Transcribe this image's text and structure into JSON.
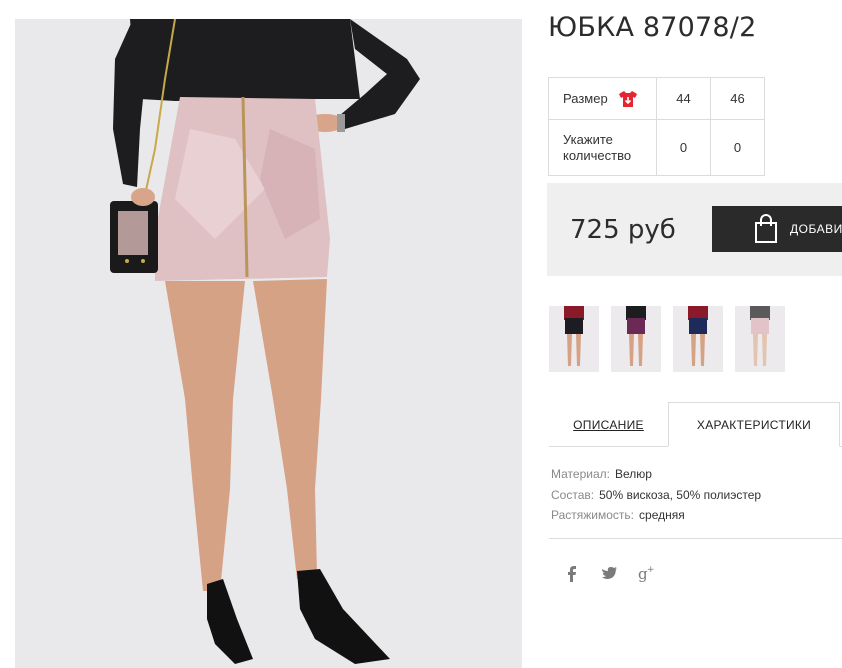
{
  "product": {
    "title": "ЮБКА 87078/2",
    "image_alt": "product-photo"
  },
  "sizes": {
    "size_label": "Размер",
    "quantity_label": "Укажите количество",
    "options": [
      {
        "size": "44",
        "quantity": "0"
      },
      {
        "size": "46",
        "quantity": "0"
      }
    ]
  },
  "purchase": {
    "price": "725 руб",
    "add_button_label": "ДОБАВИТЬ"
  },
  "thumbnails": [
    {
      "name": "black-velvet",
      "color": "#1c1c22"
    },
    {
      "name": "plum-velvet",
      "color": "#6b2a55"
    },
    {
      "name": "navy-velvet",
      "color": "#1e2a5a"
    },
    {
      "name": "pink-velvet",
      "color": "#e2c3c8"
    }
  ],
  "tabs": {
    "description": "ОПИСАНИЕ",
    "characteristics": "ХАРАКТЕРИСТИКИ"
  },
  "characteristics": [
    {
      "key": "Материал:",
      "value": "Велюр"
    },
    {
      "key": "Состав:",
      "value": "50% вискоза, 50% полиэстер"
    },
    {
      "key": "Растяжимость:",
      "value": "средняя"
    }
  ],
  "social": [
    "facebook-icon",
    "twitter-icon",
    "google-plus-icon"
  ],
  "colors": {
    "accent_red": "#e3262f",
    "button_dark": "#2a2a2a",
    "price_bg": "#efefef"
  }
}
